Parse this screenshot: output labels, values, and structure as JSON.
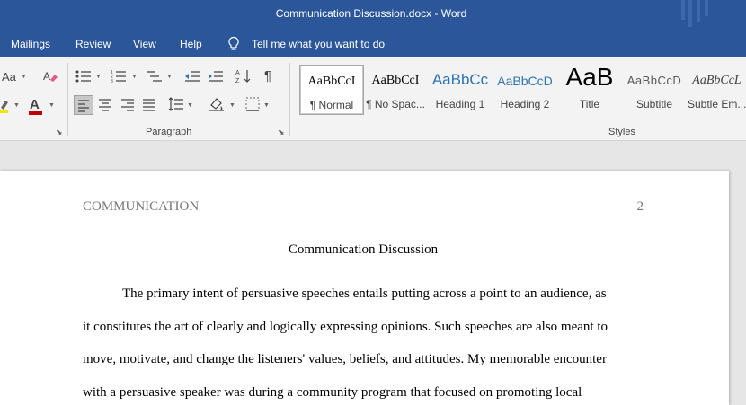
{
  "window": {
    "title": "Communication Discussion.docx  -  Word"
  },
  "menu": {
    "mailings": "Mailings",
    "review": "Review",
    "view": "View",
    "help": "Help",
    "tell_me": "Tell me what you want to do"
  },
  "ribbon": {
    "font_group": {
      "change_case": "Aa",
      "font_color_letter": "A"
    },
    "paragraph_group": {
      "label": "Paragraph"
    },
    "styles_group": {
      "label": "Styles",
      "items": [
        {
          "preview": "AaBbCcI",
          "label": "¶ Normal",
          "selected": true
        },
        {
          "preview": "AaBbCcI",
          "label": "¶ No Spac..."
        },
        {
          "preview": "AaBbCc",
          "label": "Heading 1"
        },
        {
          "preview": "AaBbCcD",
          "label": "Heading 2"
        },
        {
          "preview": "AaB",
          "label": "Title"
        },
        {
          "preview": "AaBbCcD",
          "label": "Subtitle"
        },
        {
          "preview": "AaBbCcL",
          "label": "Subtle Em..."
        }
      ]
    },
    "colors": {
      "highlight": "#f3e600",
      "font_color": "#c00000",
      "accent_blue": "#2e74b5"
    }
  },
  "document": {
    "header_left": "COMMUNICATION",
    "header_right": "2",
    "title": "Communication Discussion",
    "lines": [
      "The primary intent of persuasive speeches entails putting across a point to an audience, as",
      "it constitutes the art of clearly and logically expressing opinions. Such speeches are also meant to",
      "move, motivate, and change the listeners' values, beliefs, and attitudes. My memorable encounter",
      "with a persuasive speaker was during a community program that focused on promoting local"
    ]
  }
}
